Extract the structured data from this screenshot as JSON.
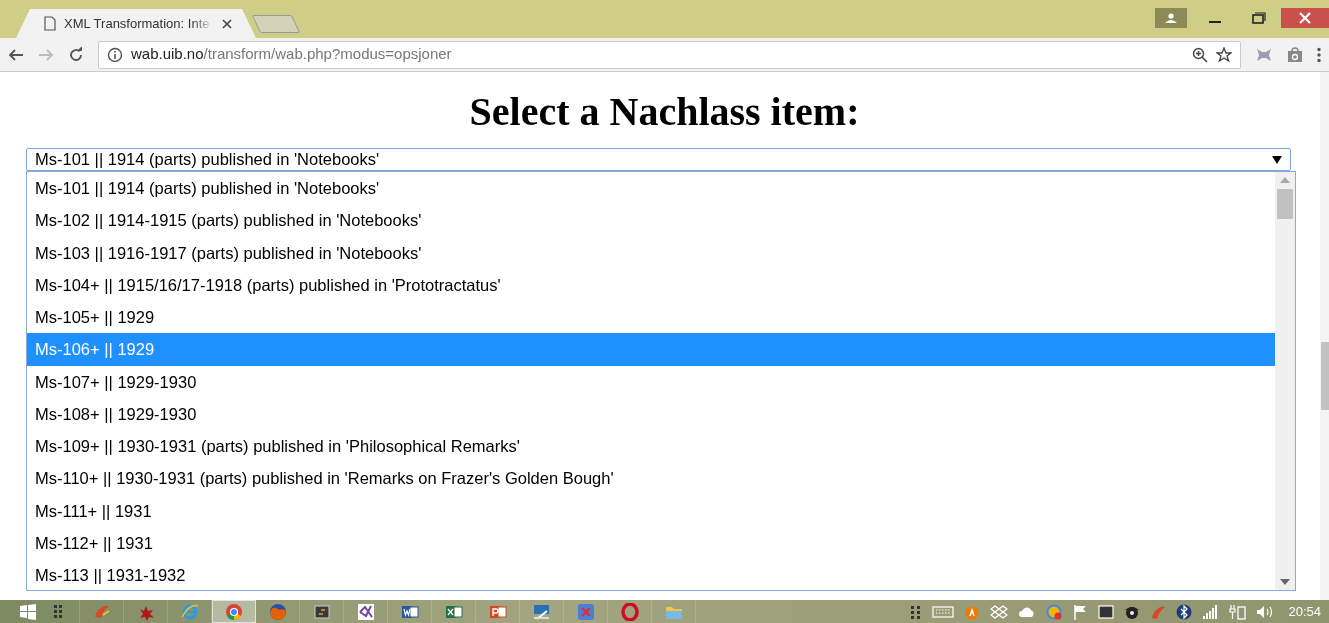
{
  "browser": {
    "tab": {
      "title": "XML Transformation: Inte",
      "selected": true
    },
    "url_host": "wab.uib.no",
    "url_path": "/transform/wab.php?modus=opsjoner"
  },
  "page": {
    "heading": "Select a Nachlass item:",
    "select": {
      "value": "Ms-101 || 1914 (parts) published in 'Notebooks'",
      "expanded": true
    },
    "options": [
      {
        "label": "Ms-101 || 1914 (parts) published in 'Notebooks'",
        "selected": false
      },
      {
        "label": "Ms-102 || 1914-1915 (parts) published in 'Notebooks'",
        "selected": false
      },
      {
        "label": "Ms-103 || 1916-1917 (parts) published in 'Notebooks'",
        "selected": false
      },
      {
        "label": "Ms-104+ || 1915/16/17-1918 (parts) published in 'Prototractatus'",
        "selected": false
      },
      {
        "label": "Ms-105+ || 1929",
        "selected": false
      },
      {
        "label": "Ms-106+ || 1929",
        "selected": true
      },
      {
        "label": "Ms-107+ || 1929-1930",
        "selected": false
      },
      {
        "label": "Ms-108+ || 1929-1930",
        "selected": false
      },
      {
        "label": "Ms-109+ || 1930-1931 (parts) published in 'Philosophical Remarks'",
        "selected": false
      },
      {
        "label": "Ms-110+ || 1930-1931 (parts) published in 'Remarks on Frazer's Golden Bough'",
        "selected": false
      },
      {
        "label": "Ms-111+ || 1931",
        "selected": false
      },
      {
        "label": "Ms-112+ || 1931",
        "selected": false
      },
      {
        "label": "Ms-113 || 1931-1932",
        "selected": false
      }
    ]
  },
  "taskbar": {
    "apps": [
      {
        "kind": "grid",
        "selected": false
      },
      {
        "kind": "brush",
        "selected": false
      },
      {
        "kind": "splat",
        "selected": false
      },
      {
        "kind": "ie",
        "selected": false
      },
      {
        "kind": "chrome",
        "selected": true
      },
      {
        "kind": "firefox",
        "selected": false
      },
      {
        "kind": "terminal",
        "selected": false
      },
      {
        "kind": "vs",
        "selected": false
      },
      {
        "kind": "word",
        "selected": false
      },
      {
        "kind": "excel",
        "selected": false
      },
      {
        "kind": "powerpoint",
        "selected": false
      },
      {
        "kind": "tool",
        "selected": false
      },
      {
        "kind": "xapp",
        "selected": false
      },
      {
        "kind": "opera",
        "selected": false
      },
      {
        "kind": "folder",
        "selected": false
      }
    ],
    "clock": "20:54"
  }
}
